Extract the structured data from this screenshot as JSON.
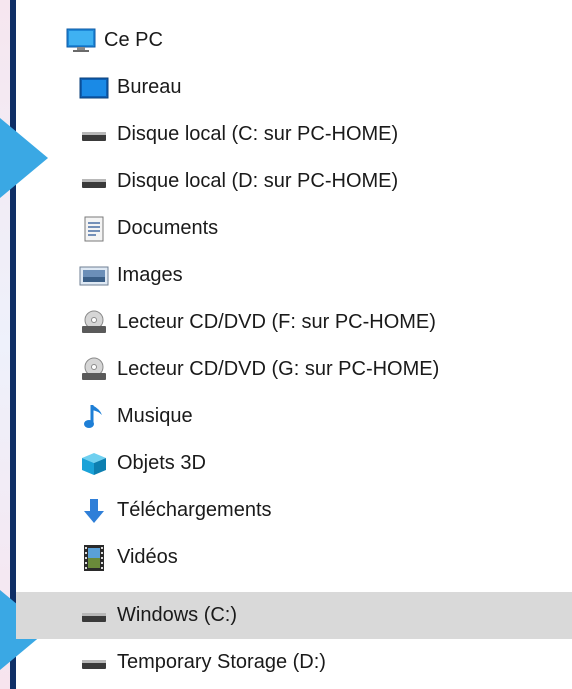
{
  "tree": {
    "root": {
      "label": "Ce PC",
      "icon": "computer-icon"
    },
    "items": [
      {
        "label": "Bureau",
        "icon": "desktop-icon"
      },
      {
        "label": "Disque local (C: sur PC-HOME)",
        "icon": "drive-icon"
      },
      {
        "label": "Disque local (D: sur PC-HOME)",
        "icon": "drive-icon"
      },
      {
        "label": "Documents",
        "icon": "documents-icon"
      },
      {
        "label": "Images",
        "icon": "pictures-icon"
      },
      {
        "label": "Lecteur CD/DVD (F: sur PC-HOME)",
        "icon": "cd-drive-icon"
      },
      {
        "label": "Lecteur CD/DVD (G: sur PC-HOME)",
        "icon": "cd-drive-icon"
      },
      {
        "label": "Musique",
        "icon": "music-icon"
      },
      {
        "label": "Objets 3D",
        "icon": "objects-3d-icon"
      },
      {
        "label": "Téléchargements",
        "icon": "downloads-icon"
      },
      {
        "label": "Vidéos",
        "icon": "videos-icon"
      },
      {
        "label": "Windows (C:)",
        "icon": "drive-icon",
        "selected": true
      },
      {
        "label": "Temporary Storage (D:)",
        "icon": "drive-icon"
      }
    ]
  },
  "colors": {
    "selection": "#d9d9d9",
    "border": "#0f2f66",
    "marker": "#3aa8e4"
  }
}
